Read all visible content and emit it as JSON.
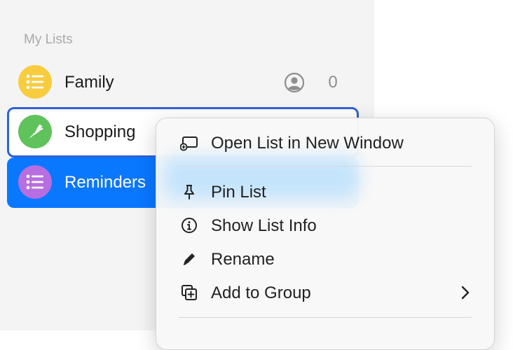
{
  "sidebar": {
    "section_header": "My Lists",
    "lists": [
      {
        "label": "Family",
        "color": "#f7cc3f",
        "icon": "list-bullet-icon",
        "shared": true,
        "count": "0"
      },
      {
        "label": "Shopping",
        "color": "#5fc25b",
        "icon": "carrot-icon",
        "focused": true
      },
      {
        "label": "Reminders",
        "color": "#b76ee0",
        "icon": "list-bullet-icon",
        "selected": true
      }
    ]
  },
  "context_menu": {
    "items": [
      {
        "label": "Open List in New Window",
        "icon": "new-window-icon"
      },
      {
        "label": "Pin List",
        "icon": "pin-icon"
      },
      {
        "label": "Show List Info",
        "icon": "info-icon"
      },
      {
        "label": "Rename",
        "icon": "pencil-icon"
      },
      {
        "label": "Add to Group",
        "icon": "add-to-group-icon",
        "submenu": true
      }
    ]
  },
  "colors": {
    "accent": "#0a77ff",
    "focus_ring": "#2f62d6"
  }
}
